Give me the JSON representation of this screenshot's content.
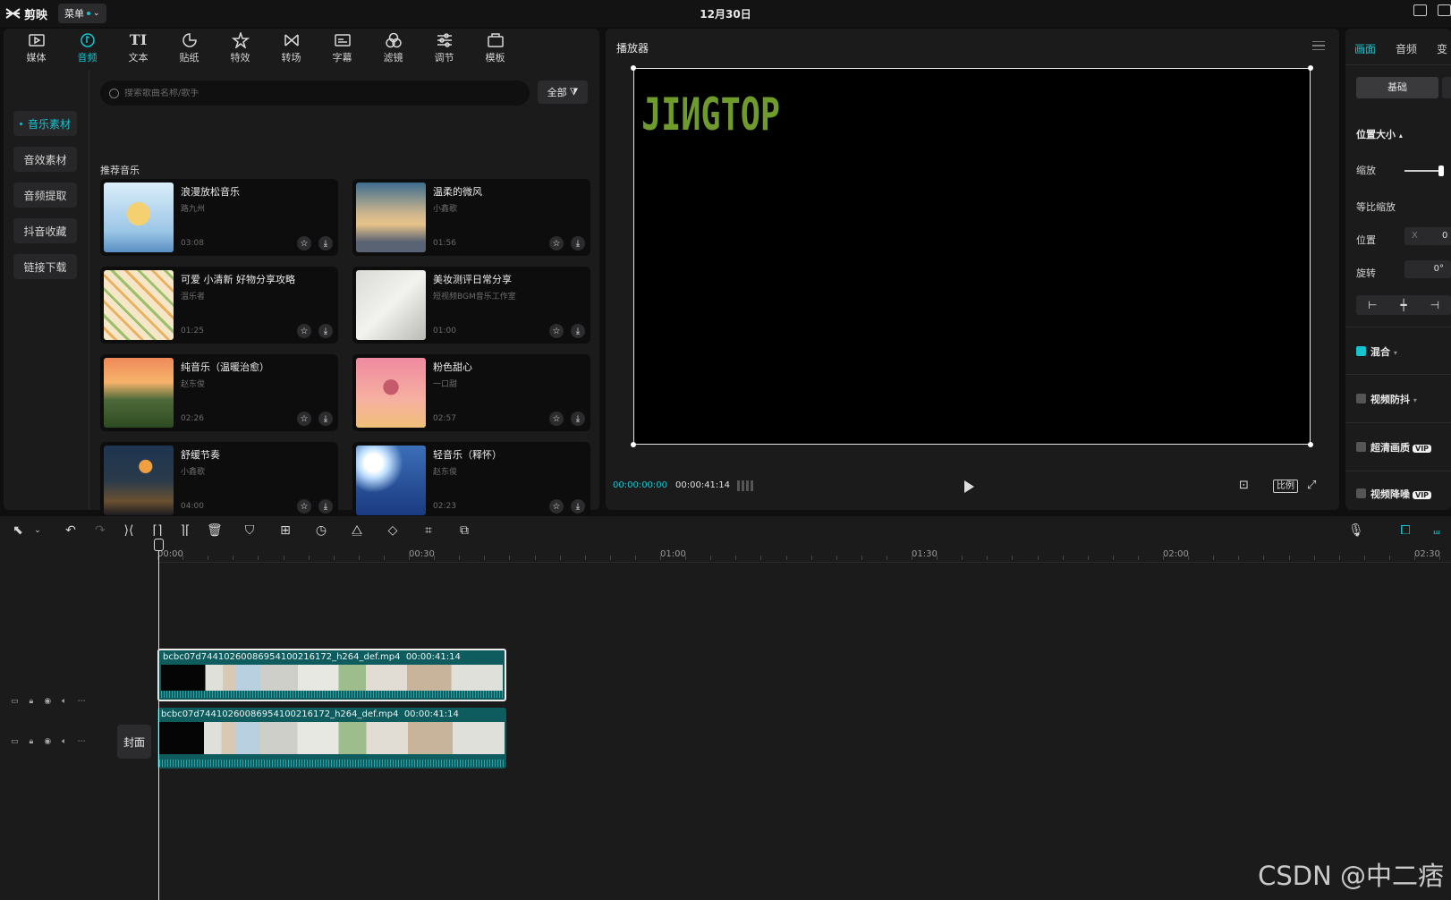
{
  "app": {
    "name": "剪映",
    "menu_label": "菜单",
    "date": "12月30日"
  },
  "tabs": [
    {
      "label": "媒体",
      "icon": "media-icon"
    },
    {
      "label": "音频",
      "icon": "audio-icon",
      "active": true
    },
    {
      "label": "文本",
      "icon": "text-icon"
    },
    {
      "label": "贴纸",
      "icon": "sticker-icon"
    },
    {
      "label": "特效",
      "icon": "effects-icon"
    },
    {
      "label": "转场",
      "icon": "transition-icon"
    },
    {
      "label": "字幕",
      "icon": "subtitle-icon"
    },
    {
      "label": "滤镜",
      "icon": "filter-icon"
    },
    {
      "label": "调节",
      "icon": "adjust-icon"
    },
    {
      "label": "模板",
      "icon": "template-icon"
    }
  ],
  "categories": [
    "音乐素材",
    "音效素材",
    "音频提取",
    "抖音收藏",
    "链接下载"
  ],
  "search": {
    "placeholder": "搜索歌曲名称/歌手"
  },
  "filter_label": "全部",
  "section_title": "推荐音乐",
  "music": [
    {
      "title": "浪漫放松音乐",
      "artist": "路九州",
      "duration": "03:08"
    },
    {
      "title": "温柔的微风",
      "artist": "小鑫歌",
      "duration": "01:56"
    },
    {
      "title": "可爱 小清新 好物分享攻略",
      "artist": "温乐者",
      "duration": "01:25"
    },
    {
      "title": "美妆测评日常分享",
      "artist": "短视频BGM音乐工作室",
      "duration": "01:00"
    },
    {
      "title": "纯音乐（温暖治愈）",
      "artist": "赵东俊",
      "duration": "02:26"
    },
    {
      "title": "粉色甜心",
      "artist": "一口甜",
      "duration": "02:57"
    },
    {
      "title": "舒缓节奏",
      "artist": "小鑫歌",
      "duration": "04:00"
    },
    {
      "title": "轻音乐（释怀）",
      "artist": "赵东俊",
      "duration": "02:23"
    }
  ],
  "player": {
    "title": "播放器",
    "logo_text": "JIИGTOP",
    "current_time": "00:00:00:00",
    "total_time": "00:00:41:14",
    "ratio_label": "比例"
  },
  "props": {
    "tabs": [
      "画面",
      "音频",
      "变"
    ],
    "basic_tab": "基础",
    "section_position": "位置大小",
    "scale_label": "缩放",
    "scale_level": 0.9,
    "ratio_scale_label": "等比缩放",
    "position_label": "位置",
    "position_x_label": "X",
    "position_x_value": "0",
    "rotate_label": "旋转",
    "rotate_value": "0°",
    "blend_label": "混合",
    "stabilize_label": "视频防抖",
    "hd_label": "超清画质",
    "vip_label": "VIP",
    "more_label": "视频降噪"
  },
  "timeline": {
    "ruler": [
      "00:00",
      "00:30",
      "01:00",
      "01:30",
      "02:00",
      "02:30"
    ],
    "cover_label": "封面",
    "clip_name": "bcbc07d74410260086954100216172_h264_def.mp4",
    "clip_duration": "00:00:41:14"
  },
  "watermark": "CSDN @中二痞"
}
